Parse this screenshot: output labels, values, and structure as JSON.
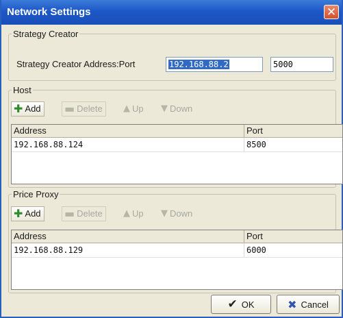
{
  "window": {
    "title": "Network Settings",
    "close_glyph": "✕"
  },
  "strategy": {
    "legend": "Strategy Creator",
    "label": "Strategy Creator Address:Port",
    "address": "192.168.88.2",
    "port": "5000"
  },
  "host": {
    "legend": "Host",
    "add_label": "Add",
    "delete_label": "Delete",
    "up_label": "Up",
    "down_label": "Down",
    "columns": [
      "Address",
      "Port"
    ],
    "rows": [
      {
        "address": "192.168.88.124",
        "port": "8500"
      }
    ]
  },
  "price": {
    "legend": "Price Proxy",
    "add_label": "Add",
    "delete_label": "Delete",
    "up_label": "Up",
    "down_label": "Down",
    "columns": [
      "Address",
      "Port"
    ],
    "rows": [
      {
        "address": "192.168.88.129",
        "port": "6000"
      }
    ]
  },
  "buttons": {
    "ok_label": "OK",
    "cancel_label": "Cancel"
  },
  "icons": {
    "add": "plus-icon",
    "delete": "minus-icon",
    "up": "arrow-up-icon",
    "down": "arrow-down-icon",
    "ok": "checkmark-icon",
    "cancel": "x-mark-icon",
    "close": "close-icon"
  },
  "colors": {
    "titlebar": "#1d58c8",
    "window_bg": "#ece9d8",
    "selection": "#316ac5",
    "add_icon": "#2d8a2d",
    "cancel_icon": "#3355aa"
  }
}
